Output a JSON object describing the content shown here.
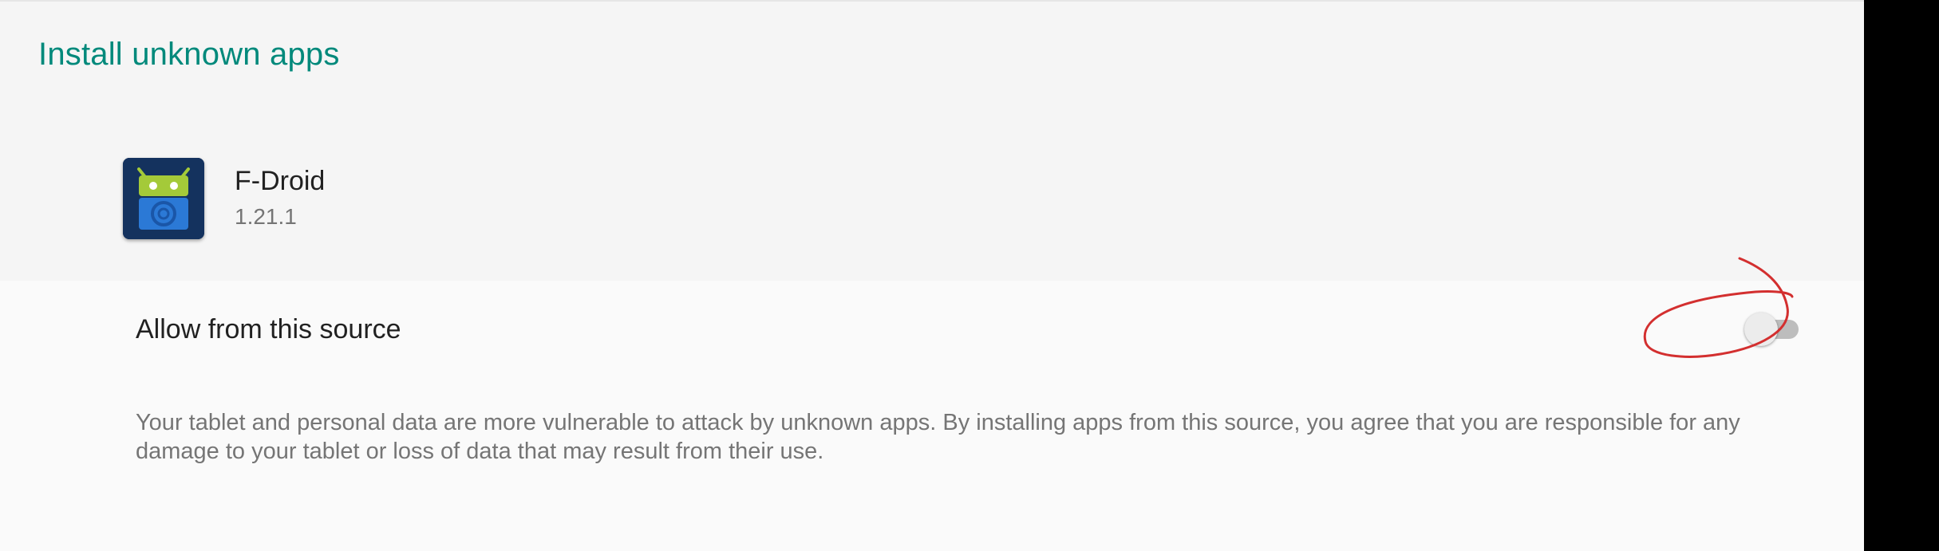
{
  "page": {
    "title": "Install unknown apps"
  },
  "app": {
    "name": "F-Droid",
    "version": "1.21.1",
    "icon": "f-droid-app-icon"
  },
  "allow_setting": {
    "label": "Allow from this source",
    "enabled": false
  },
  "warning": {
    "text": "Your tablet and personal data are more vulnerable to attack by unknown apps. By installing apps from this source, you agree that you are responsible for any damage to your tablet or loss of data that may result from their use."
  },
  "colors": {
    "title_accent": "#00897b",
    "annotation_mark": "#d32f2f"
  }
}
